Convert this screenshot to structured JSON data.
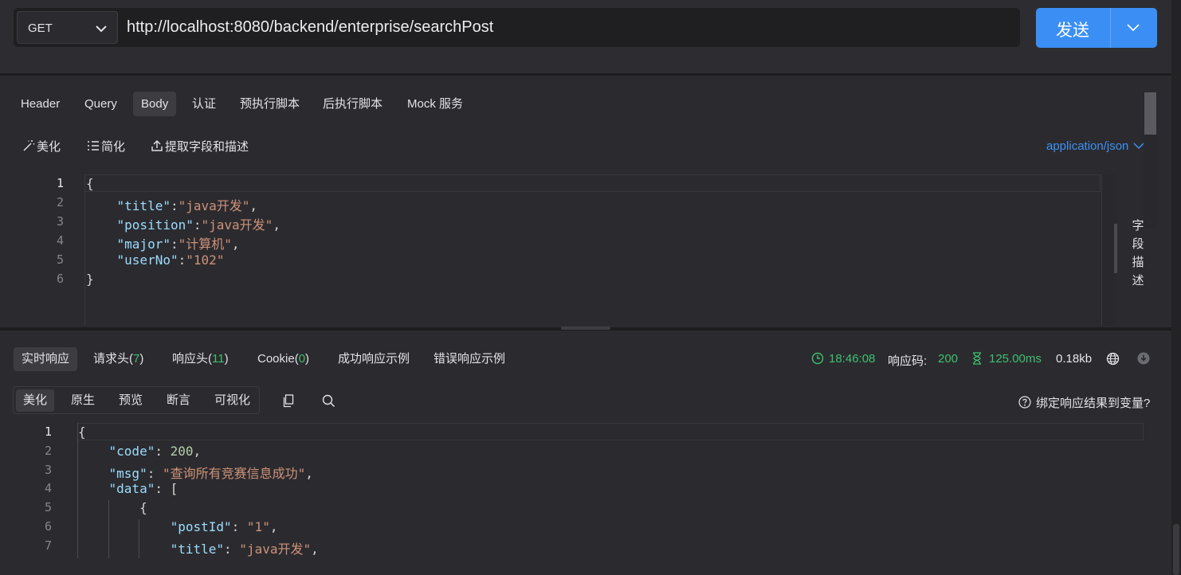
{
  "request": {
    "method": "GET",
    "url": "http://localhost:8080/backend/enterprise/searchPost",
    "send_label": "发送"
  },
  "request_tabs": [
    {
      "label": "Header"
    },
    {
      "label": "Query"
    },
    {
      "label": "Body",
      "active": true
    },
    {
      "label": "认证"
    },
    {
      "label": "预执行脚本"
    },
    {
      "label": "后执行脚本"
    },
    {
      "label": "Mock 服务"
    }
  ],
  "body_toolbar": {
    "beautify": "美化",
    "simplify": "简化",
    "extract": "提取字段和描述",
    "content_type": "application/json"
  },
  "side_panel_label": "字段描述",
  "request_body_lines": [
    {
      "no": "1",
      "parts": [
        {
          "t": "{",
          "c": "p"
        }
      ]
    },
    {
      "no": "2",
      "parts": [
        {
          "t": "    ",
          "c": "p"
        },
        {
          "t": "\"title\"",
          "c": "k"
        },
        {
          "t": ":",
          "c": "p"
        },
        {
          "t": "\"java开发\"",
          "c": "s"
        },
        {
          "t": ",",
          "c": "p"
        }
      ]
    },
    {
      "no": "3",
      "parts": [
        {
          "t": "    ",
          "c": "p"
        },
        {
          "t": "\"position\"",
          "c": "k"
        },
        {
          "t": ":",
          "c": "p"
        },
        {
          "t": "\"java开发\"",
          "c": "s"
        },
        {
          "t": ",",
          "c": "p"
        }
      ]
    },
    {
      "no": "4",
      "parts": [
        {
          "t": "    ",
          "c": "p"
        },
        {
          "t": "\"major\"",
          "c": "k"
        },
        {
          "t": ":",
          "c": "p"
        },
        {
          "t": "\"计算机\"",
          "c": "s"
        },
        {
          "t": ",",
          "c": "p"
        }
      ]
    },
    {
      "no": "5",
      "parts": [
        {
          "t": "    ",
          "c": "p"
        },
        {
          "t": "\"userNo\"",
          "c": "k"
        },
        {
          "t": ":",
          "c": "p"
        },
        {
          "t": "\"102\"",
          "c": "s"
        }
      ]
    },
    {
      "no": "6",
      "parts": [
        {
          "t": "}",
          "c": "p"
        }
      ]
    }
  ],
  "response_tabs": {
    "realtime": "实时响应",
    "req_headers": "请求头(",
    "req_headers_count": "7",
    "resp_headers": "响应头(",
    "resp_headers_count": "11",
    "cookie": "Cookie(",
    "cookie_count": "0",
    "close_paren": ")",
    "success_example": "成功响应示例",
    "error_example": "错误响应示例"
  },
  "response_meta": {
    "time": "18:46:08",
    "status_label": "响应码:",
    "status_code": "200",
    "duration": "125.00ms",
    "size": "0.18kb"
  },
  "view_tabs": [
    {
      "label": "美化",
      "active": true
    },
    {
      "label": "原生"
    },
    {
      "label": "预览"
    },
    {
      "label": "断言"
    },
    {
      "label": "可视化"
    }
  ],
  "bind_label": "绑定响应结果到变量?",
  "response_body_lines": [
    {
      "no": "1",
      "parts": [
        {
          "t": "{",
          "c": "p"
        }
      ]
    },
    {
      "no": "2",
      "parts": [
        {
          "t": "    ",
          "c": "p"
        },
        {
          "t": "\"code\"",
          "c": "k"
        },
        {
          "t": ": ",
          "c": "p"
        },
        {
          "t": "200",
          "c": "n"
        },
        {
          "t": ",",
          "c": "p"
        }
      ]
    },
    {
      "no": "3",
      "parts": [
        {
          "t": "    ",
          "c": "p"
        },
        {
          "t": "\"msg\"",
          "c": "k"
        },
        {
          "t": ": ",
          "c": "p"
        },
        {
          "t": "\"查询所有竞赛信息成功\"",
          "c": "s"
        },
        {
          "t": ",",
          "c": "p"
        }
      ]
    },
    {
      "no": "4",
      "parts": [
        {
          "t": "    ",
          "c": "p"
        },
        {
          "t": "\"data\"",
          "c": "k"
        },
        {
          "t": ": [",
          "c": "p"
        }
      ]
    },
    {
      "no": "5",
      "parts": [
        {
          "t": "        {",
          "c": "p"
        }
      ]
    },
    {
      "no": "6",
      "parts": [
        {
          "t": "            ",
          "c": "p"
        },
        {
          "t": "\"postId\"",
          "c": "k"
        },
        {
          "t": ": ",
          "c": "p"
        },
        {
          "t": "\"1\"",
          "c": "s"
        },
        {
          "t": ",",
          "c": "p"
        }
      ]
    },
    {
      "no": "7",
      "parts": [
        {
          "t": "            ",
          "c": "p"
        },
        {
          "t": "\"title\"",
          "c": "k"
        },
        {
          "t": ": ",
          "c": "p"
        },
        {
          "t": "\"java开发\"",
          "c": "s"
        },
        {
          "t": ",",
          "c": "p"
        }
      ]
    }
  ],
  "colors": {
    "accent": "#3b8ff4",
    "success": "#3fbf6f",
    "json_key": "#9cdcfe",
    "json_string": "#ce9178",
    "json_number": "#b5cea8"
  }
}
